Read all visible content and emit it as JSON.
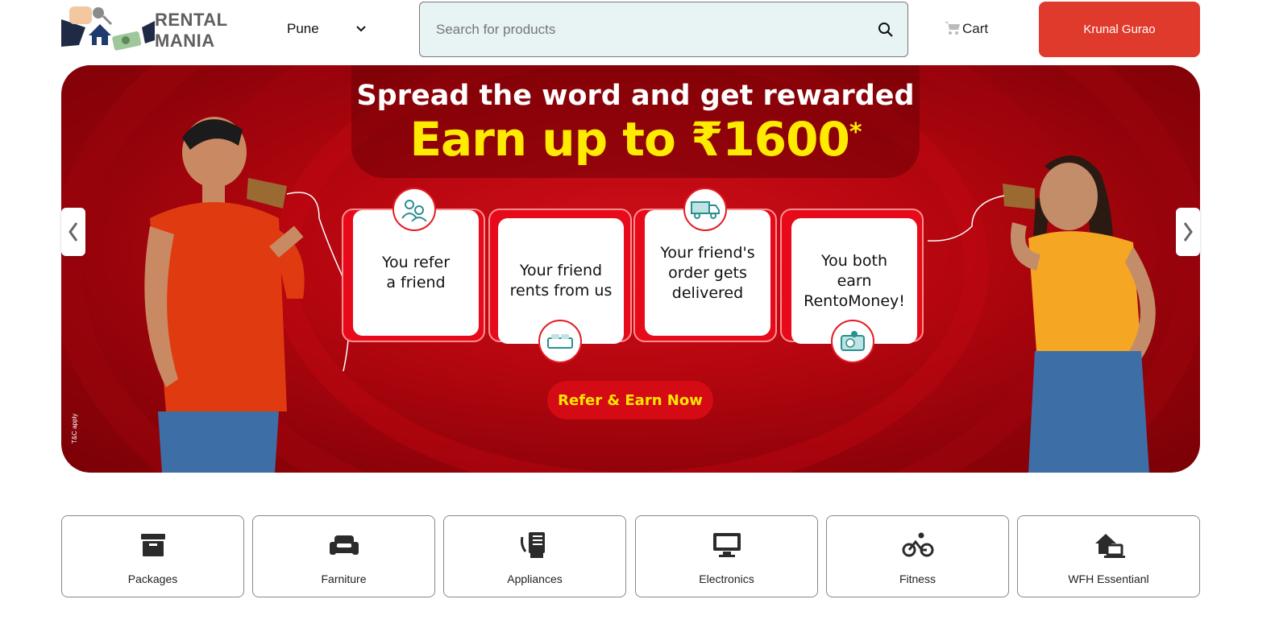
{
  "header": {
    "logo_line1": "RENTAL",
    "logo_line2": "MANIA",
    "city": "Pune",
    "search_placeholder": "Search for products",
    "cart_label": "Cart",
    "user_name": "Krunal Gurao"
  },
  "banner": {
    "headline": "Spread the word and get rewarded",
    "earn_text": "Earn up to ₹1600",
    "earn_asterisk": "*",
    "steps": [
      {
        "label": "You refer a friend",
        "icon": "refer-people-icon"
      },
      {
        "label": "Your friend rents from us",
        "icon": "bed-icon"
      },
      {
        "label": "Your friend's order gets delivered",
        "icon": "delivery-truck-icon"
      },
      {
        "label": "You both earn RentoMoney!",
        "icon": "wallet-icon"
      }
    ],
    "cta": "Refer & Earn Now",
    "tnc": "T&C apply",
    "colors": {
      "background": "#b5060f",
      "headline": "#ffffff",
      "earn": "#ffeb00",
      "cta_text": "#ffe600"
    }
  },
  "categories": [
    {
      "label": "Packages",
      "icon": "package-box-icon"
    },
    {
      "label": "Farniture",
      "icon": "sofa-icon"
    },
    {
      "label": "Appliances",
      "icon": "appliance-icon"
    },
    {
      "label": "Electronics",
      "icon": "monitor-icon"
    },
    {
      "label": "Fitness",
      "icon": "bicycle-icon"
    },
    {
      "label": "WFH Essentianl",
      "icon": "home-office-icon"
    }
  ],
  "colors": {
    "accent": "#e03a2c",
    "search_bg": "#e8f3f3"
  }
}
